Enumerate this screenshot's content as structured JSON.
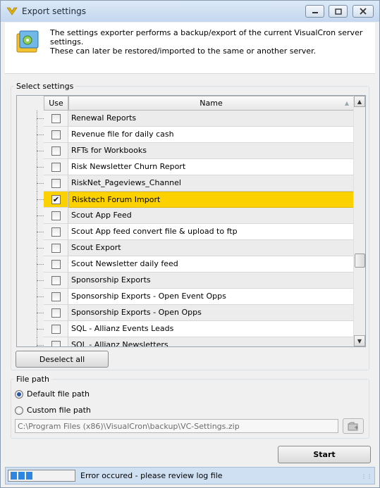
{
  "window": {
    "title": "Export settings"
  },
  "header": {
    "description_line1": "The settings exporter performs a backup/export of the current VisualCron server settings.",
    "description_line2": "These can later be restored/imported to the same or another server."
  },
  "settings": {
    "group_label": "Select settings",
    "columns": {
      "use": "Use",
      "name": "Name"
    },
    "rows": [
      {
        "name": "Renewal Reports",
        "checked": false
      },
      {
        "name": "Revenue file for daily cash",
        "checked": false
      },
      {
        "name": "RFTs for Workbooks",
        "checked": false
      },
      {
        "name": "Risk Newsletter Churn Report",
        "checked": false
      },
      {
        "name": "RiskNet_Pageviews_Channel",
        "checked": false
      },
      {
        "name": "Risktech Forum Import",
        "checked": true,
        "selected": true
      },
      {
        "name": "Scout App Feed",
        "checked": false
      },
      {
        "name": "Scout App feed convert file & upload to ftp",
        "checked": false
      },
      {
        "name": "Scout Export",
        "checked": false
      },
      {
        "name": "Scout Newsletter daily feed",
        "checked": false
      },
      {
        "name": "Sponsorship Exports",
        "checked": false
      },
      {
        "name": "Sponsorship Exports - Open Event Opps",
        "checked": false
      },
      {
        "name": "Sponsorship Exports - Open Opps",
        "checked": false
      },
      {
        "name": "SQL - Allianz Events Leads",
        "checked": false
      },
      {
        "name": "SQL - Allianz Newsletters",
        "checked": false
      }
    ],
    "deselect_all": "Deselect all"
  },
  "file_path": {
    "group_label": "File path",
    "default_option": "Default file path",
    "custom_option": "Custom file path",
    "selected": "default",
    "path_value": "C:\\Program Files (x86)\\VisualCron\\backup\\VC-Settings.zip"
  },
  "actions": {
    "start": "Start"
  },
  "status": {
    "message": "Error occured - please review log file",
    "progress_blocks": 3
  },
  "icons": {
    "app": "visualcron-logo-icon",
    "header": "settings-export-icon",
    "browse": "browse-folder-icon"
  },
  "colors": {
    "selected_row": "#fbd200",
    "progress": "#2f86e0",
    "statusbar": "#cfe0f3"
  }
}
